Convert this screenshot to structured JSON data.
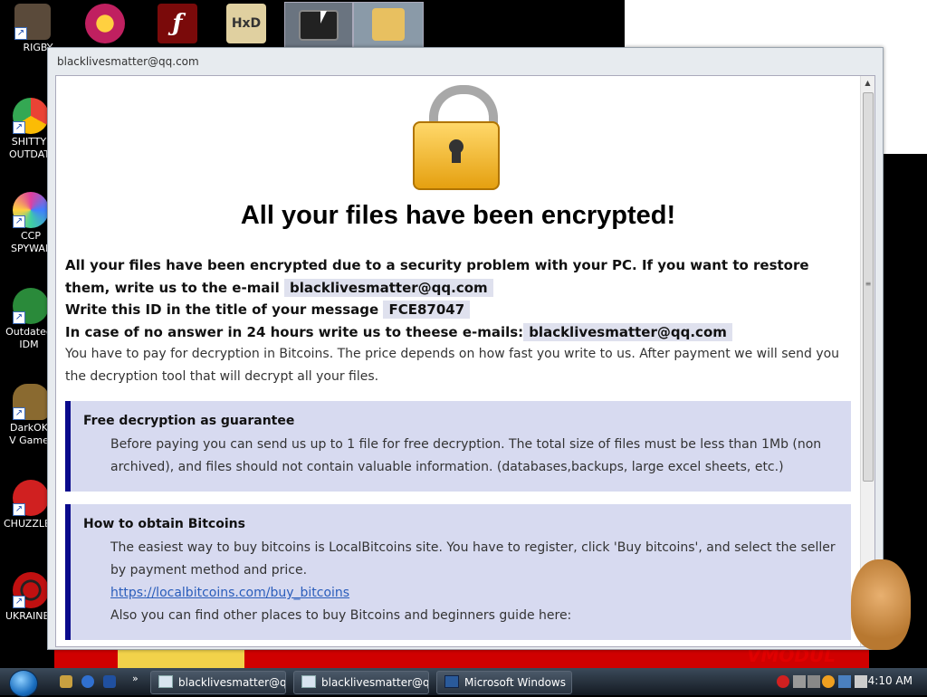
{
  "desktop": {
    "icons_left": [
      {
        "label": "RIGBY",
        "icon": "raccoon-icon",
        "color": "#5a4a3a"
      },
      {
        "label": "SHITTY OUTDATED",
        "icon": "chrome-icon",
        "color": "#34a853"
      },
      {
        "label": "CCP SPYWARE",
        "icon": "photos-icon",
        "color": "#c040c0"
      },
      {
        "label": "Outdated IDM Crack",
        "icon": "idm-icon",
        "color": "#2a8a3a"
      },
      {
        "label": "DarkOK V Game",
        "icon": "money-bag-icon",
        "color": "#8a6a30"
      },
      {
        "label": "CHUZZLE",
        "icon": "chuzzle-icon",
        "color": "#d02020"
      },
      {
        "label": "UKRAINE",
        "icon": "radiation-icon",
        "color": "#c01010"
      }
    ],
    "icons_top": [
      {
        "icon": "pinball-icon",
        "color": "#c02060"
      },
      {
        "icon": "flash-icon",
        "color": "#7a0a0a"
      },
      {
        "icon": "hxd-icon",
        "color": "#e0d0a0"
      },
      {
        "icon": "terminal-icon",
        "color": "#222222"
      },
      {
        "icon": "folder-icon",
        "color": "#e8c060"
      }
    ],
    "wallpaper_logo": "VMODUL"
  },
  "window": {
    "title": "blacklivesmatter@qq.com",
    "heading": "All your files have been encrypted!",
    "para1_a": "All your files have been encrypted due to a security problem with your PC. If you want to restore them, write us to the e-mail ",
    "email": "blacklivesmatter@qq.com",
    "para2_a": "Write this ID in the title of your message ",
    "id": "FCE87047",
    "para3_a": "In case of no answer in 24 hours write us to theese e-mails:",
    "email2": "blacklivesmatter@qq.com",
    "para4": "You have to pay for decryption in Bitcoins. The price depends on how fast you write to us. After payment we will send you the decryption tool that will decrypt all your files.",
    "box1": {
      "title": "Free decryption as guarantee",
      "text": "Before paying you can send us up to 1 file for free decryption. The total size of files must be less than 1Mb (non archived), and files should not contain valuable information. (databases,backups, large excel sheets, etc.)"
    },
    "box2": {
      "title": "How to obtain Bitcoins",
      "text": "The easiest way to buy bitcoins is LocalBitcoins site. You have to register, click 'Buy bitcoins', and select the seller by payment method and price.",
      "link": "https://localbitcoins.com/buy_bitcoins",
      "text2": "Also you can find other places to buy Bitcoins and beginners guide here:"
    }
  },
  "taskbar": {
    "quick_more": "»",
    "buttons": [
      {
        "label": "blacklivesmatter@q..."
      },
      {
        "label": "blacklivesmatter@q..."
      },
      {
        "label": "Microsoft Windows"
      }
    ],
    "clock": "4:10 AM"
  },
  "colors": {
    "accent_bar": "#0a0a8c",
    "box_bg": "#d7daf0",
    "link": "#2a5dbb"
  }
}
